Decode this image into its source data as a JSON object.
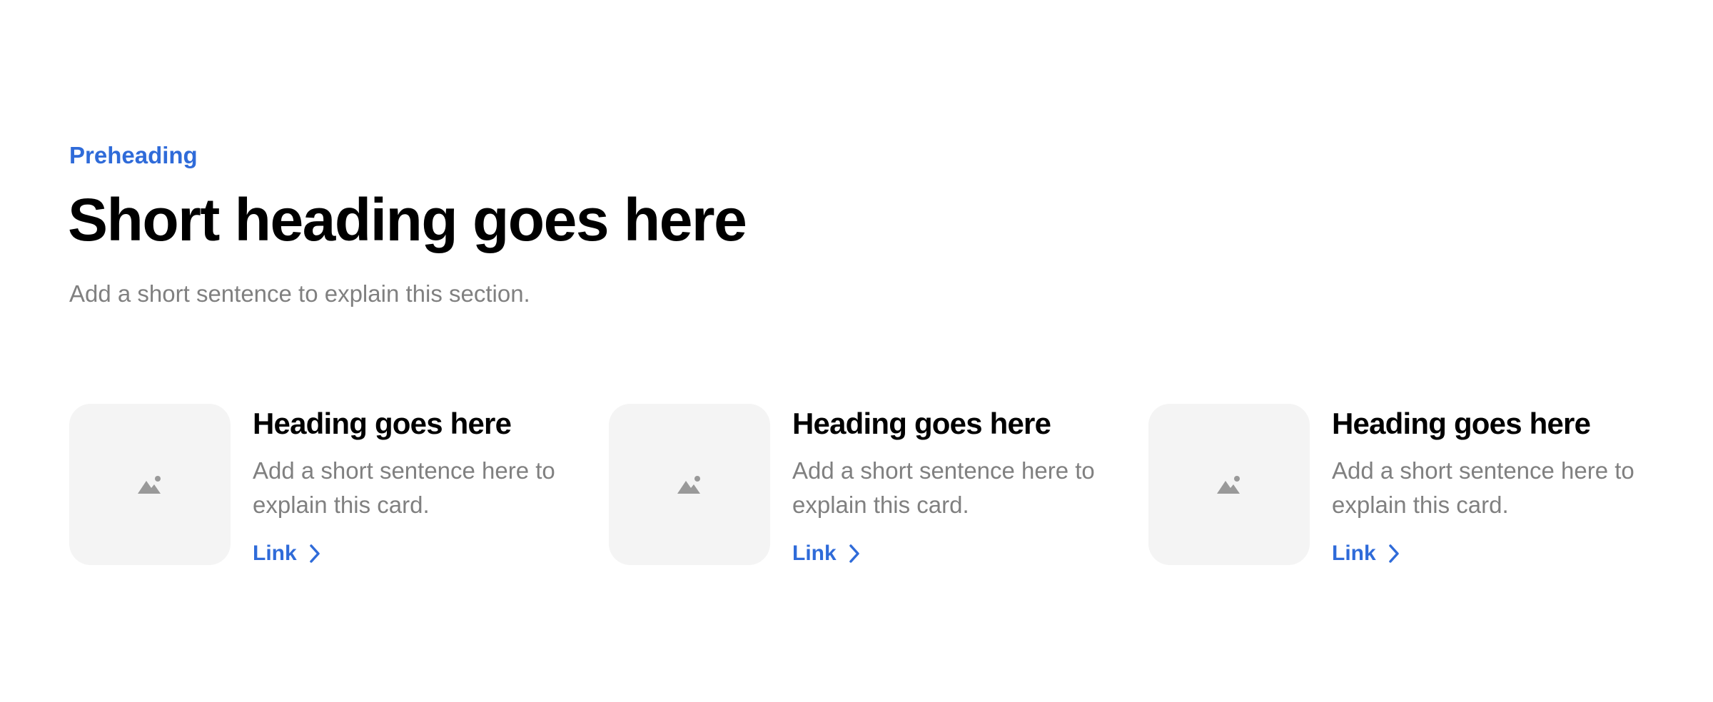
{
  "section": {
    "preheading": "Preheading",
    "heading": "Short heading goes here",
    "subtitle": "Add a short sentence to explain this section."
  },
  "cards": [
    {
      "heading": "Heading goes here",
      "text": "Add a short sentence here to explain this card.",
      "link_label": "Link",
      "icon": "image-placeholder-icon"
    },
    {
      "heading": "Heading goes here",
      "text": "Add a short sentence here to explain this card.",
      "link_label": "Link",
      "icon": "image-placeholder-icon"
    },
    {
      "heading": "Heading goes here",
      "text": "Add a short sentence here to explain this card.",
      "link_label": "Link",
      "icon": "image-placeholder-icon"
    }
  ],
  "colors": {
    "accent": "#2f6bd9",
    "muted_text": "#808080",
    "placeholder_bg": "#f4f4f4",
    "placeholder_icon": "#999999"
  }
}
